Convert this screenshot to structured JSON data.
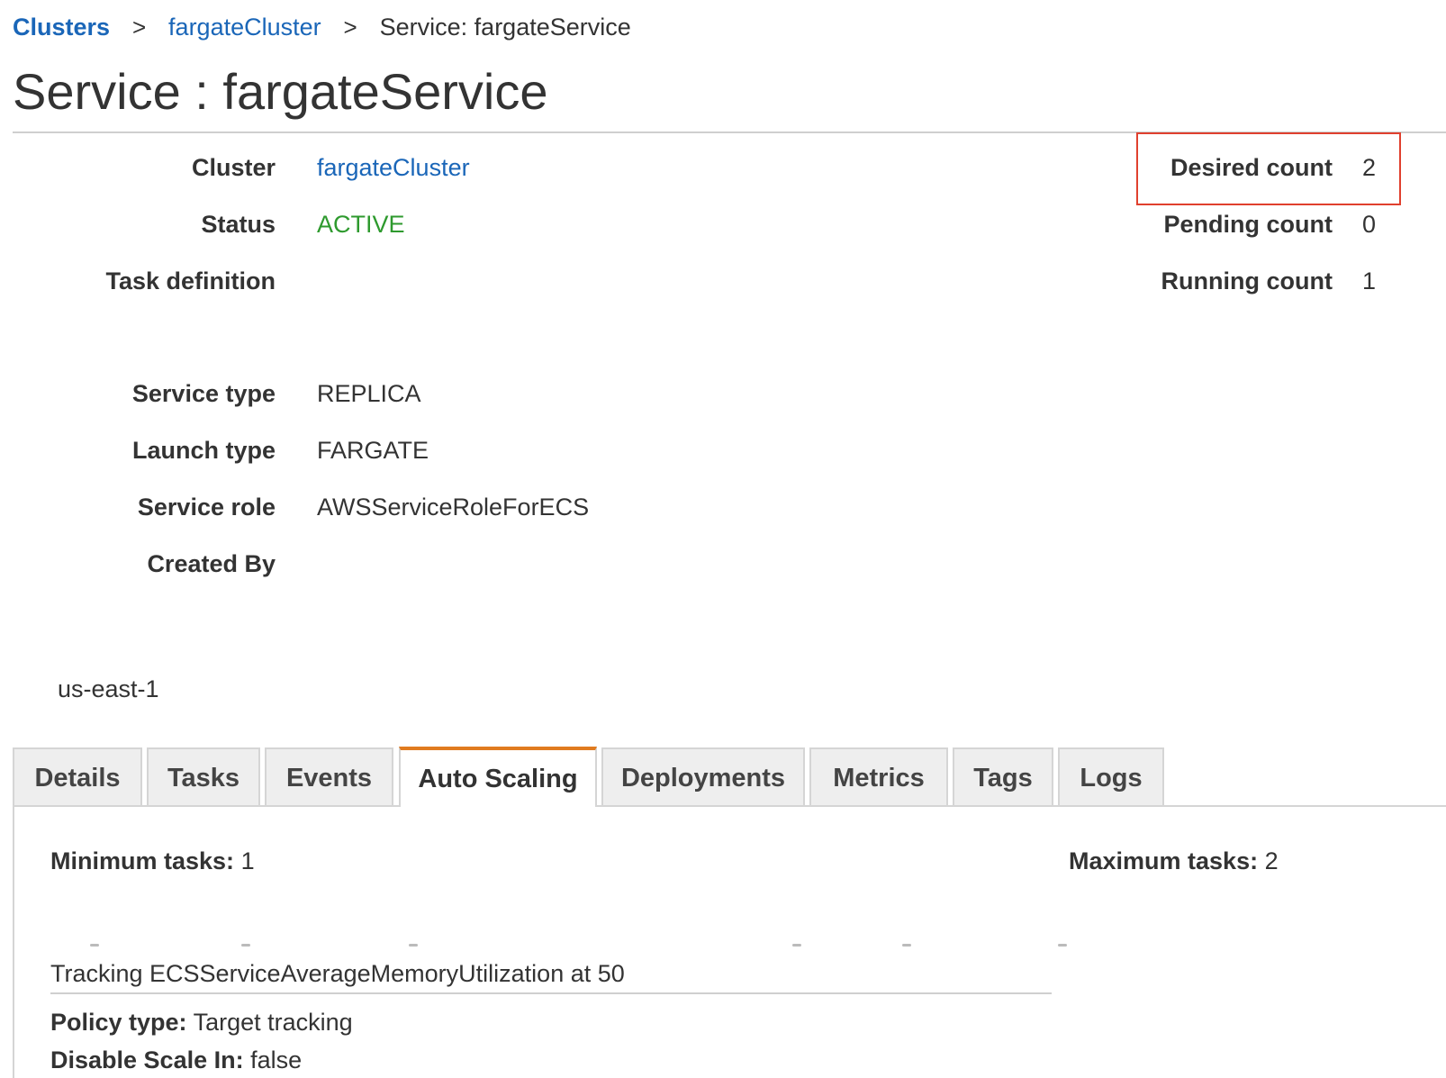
{
  "breadcrumb": {
    "root": "Clusters",
    "separator": ">",
    "cluster": "fargateCluster",
    "current": "Service: fargateService"
  },
  "title": "Service : fargateService",
  "details": {
    "cluster_label": "Cluster",
    "cluster_value": "fargateCluster",
    "status_label": "Status",
    "status_value": "ACTIVE",
    "task_definition_label": "Task definition",
    "service_type_label": "Service type",
    "service_type_value": "REPLICA",
    "launch_type_label": "Launch type",
    "launch_type_value": "FARGATE",
    "service_role_label": "Service role",
    "service_role_value": "AWSServiceRoleForECS",
    "created_by_label": "Created By",
    "region": "us-east-1"
  },
  "counts": {
    "desired_label": "Desired count",
    "desired_value": "2",
    "pending_label": "Pending count",
    "pending_value": "0",
    "running_label": "Running count",
    "running_value": "1"
  },
  "tabs": [
    {
      "label": "Details"
    },
    {
      "label": "Tasks"
    },
    {
      "label": "Events"
    },
    {
      "label": "Auto Scaling"
    },
    {
      "label": "Deployments"
    },
    {
      "label": "Metrics"
    },
    {
      "label": "Tags"
    },
    {
      "label": "Logs"
    }
  ],
  "active_tab": "Auto Scaling",
  "auto_scaling": {
    "min_label": "Minimum tasks:",
    "min_value": "1",
    "max_label": "Maximum tasks:",
    "max_value": "2",
    "policy_name": "Tracking ECSServiceAverageMemoryUtilization at 50",
    "policy_type_label": "Policy type:",
    "policy_type_value": "Target tracking",
    "disable_scale_in_label": "Disable Scale In:",
    "disable_scale_in_value": "false"
  },
  "colors": {
    "link": "#1a66b8",
    "status_active": "#2e9a2e",
    "highlight": "#e0402e",
    "active_tab_accent": "#e07b1f"
  }
}
